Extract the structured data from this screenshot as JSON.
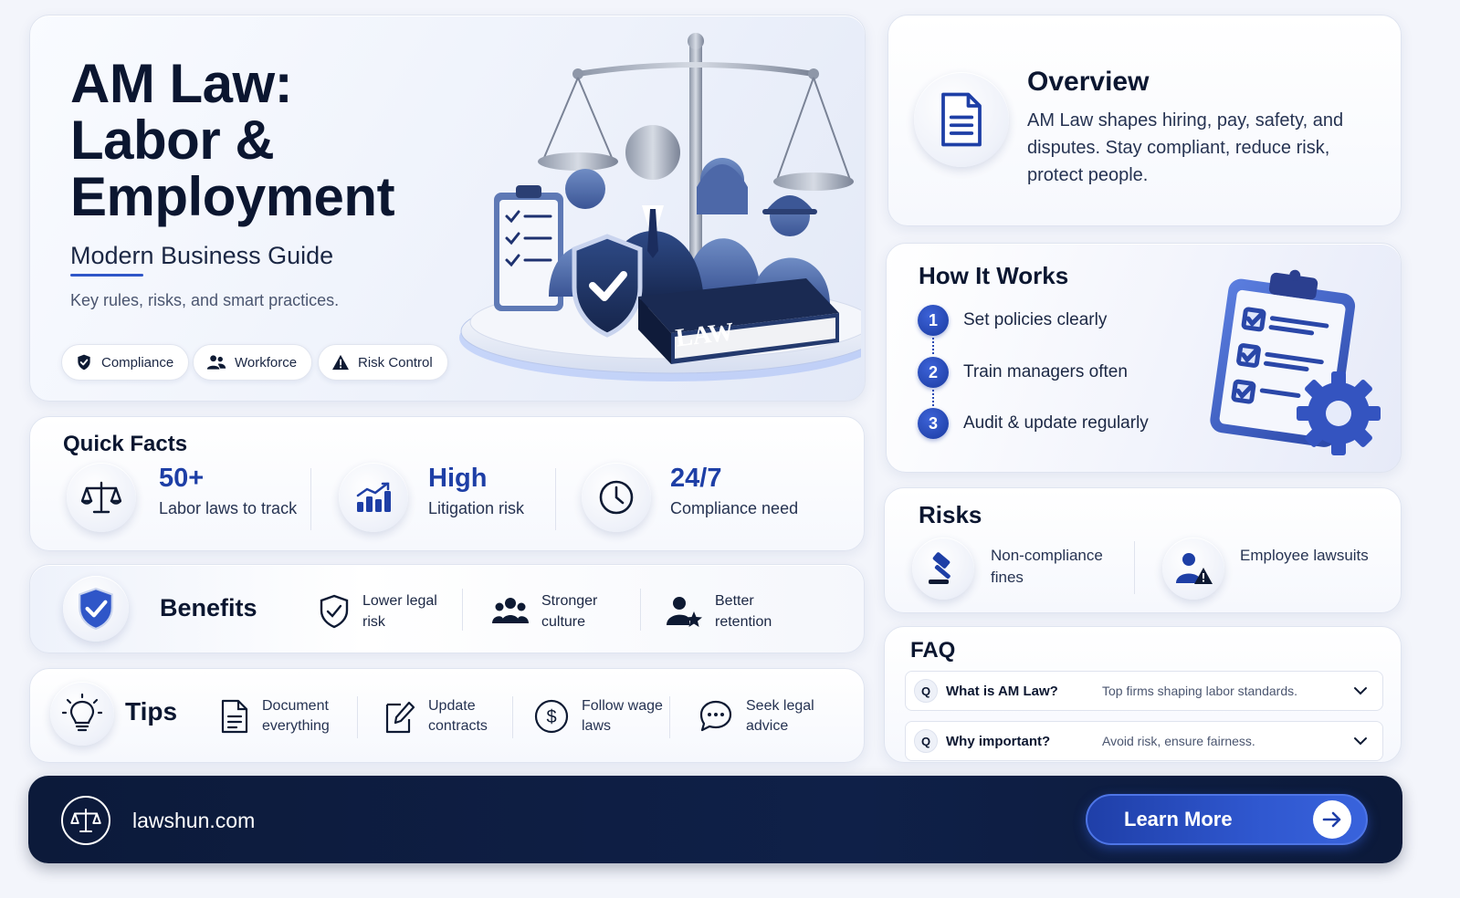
{
  "hero": {
    "title": "AM Law: Labor & Employment",
    "subtitle": "Modern Business Guide",
    "tagline": "Key rules, risks, and smart practices.",
    "pills": [
      "Compliance",
      "Workforce",
      "Risk Control"
    ],
    "book_label": "LAW"
  },
  "overview": {
    "title": "Overview",
    "text": "AM Law shapes hiring, pay, safety, and disputes. Stay compliant, reduce risk, protect people."
  },
  "how": {
    "title": "How It Works",
    "steps": [
      {
        "num": "1",
        "label": "Set policies clearly"
      },
      {
        "num": "2",
        "label": "Train managers often"
      },
      {
        "num": "3",
        "label": "Audit & update regularly"
      }
    ]
  },
  "facts": {
    "title": "Quick Facts",
    "items": [
      {
        "value": "50+",
        "label": "Labor laws to track",
        "icon": "scales-icon"
      },
      {
        "value": "High",
        "label": "Litigation risk",
        "icon": "bar-chart-icon"
      },
      {
        "value": "24/7",
        "label": "Compliance need",
        "icon": "clock-icon"
      }
    ]
  },
  "benefits": {
    "title": "Benefits",
    "items": [
      {
        "label": "Lower legal risk",
        "icon": "shield-check-icon"
      },
      {
        "label": "Stronger culture",
        "icon": "team-icon"
      },
      {
        "label": "Better retention",
        "icon": "user-star-icon"
      }
    ]
  },
  "tips": {
    "title": "Tips",
    "items": [
      {
        "label": "Document everything",
        "icon": "document-icon"
      },
      {
        "label": "Update contracts",
        "icon": "edit-icon"
      },
      {
        "label": "Follow wage laws",
        "icon": "dollar-icon"
      },
      {
        "label": "Seek legal advice",
        "icon": "chat-icon"
      }
    ]
  },
  "risks": {
    "title": "Risks",
    "items": [
      {
        "label": "Non-compliance fines",
        "icon": "gavel-icon"
      },
      {
        "label": "Employee lawsuits",
        "icon": "user-warning-icon"
      }
    ]
  },
  "faq": {
    "title": "FAQ",
    "items": [
      {
        "q": "Q",
        "question": "What is AM Law?",
        "answer": "Top firms shaping labor standards."
      },
      {
        "q": "Q",
        "question": "Why important?",
        "answer": "Avoid risk, ensure fairness."
      }
    ]
  },
  "footer": {
    "site": "lawshun.com",
    "cta": "Learn More"
  },
  "colors": {
    "accent": "#2f56c8",
    "navy": "#0c1a3a",
    "text": "#0b1630"
  }
}
